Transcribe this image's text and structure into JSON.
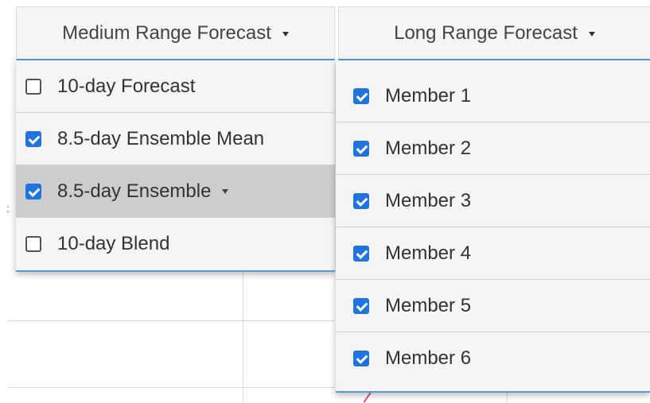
{
  "colors": {
    "accent": "#5b9bd5",
    "checkbox_checked": "#1f74e0",
    "menu_bg": "#f5f5f5",
    "highlight_bg": "#cdcdcd"
  },
  "toolbar": {
    "medium_range_label": "Medium Range Forecast",
    "long_range_label": "Long Range Forecast"
  },
  "medium_menu": {
    "items": [
      {
        "label": "10-day Forecast",
        "checked": false,
        "icon": "checkbox-unchecked-icon"
      },
      {
        "label": "8.5-day Ensemble Mean",
        "checked": true,
        "icon": "checkbox-checked-icon"
      },
      {
        "label": "8.5-day Ensemble",
        "checked": true,
        "icon": "checkbox-checked-icon",
        "has_submenu": true,
        "highlighted": true
      },
      {
        "label": "10-day Blend",
        "checked": false,
        "icon": "checkbox-unchecked-icon"
      }
    ]
  },
  "long_menu": {
    "items": [
      {
        "label": "Member 1",
        "checked": true
      },
      {
        "label": "Member 2",
        "checked": true
      },
      {
        "label": "Member 3",
        "checked": true
      },
      {
        "label": "Member 4",
        "checked": true
      },
      {
        "label": "Member 5",
        "checked": true
      },
      {
        "label": "Member 6",
        "checked": true
      }
    ]
  }
}
